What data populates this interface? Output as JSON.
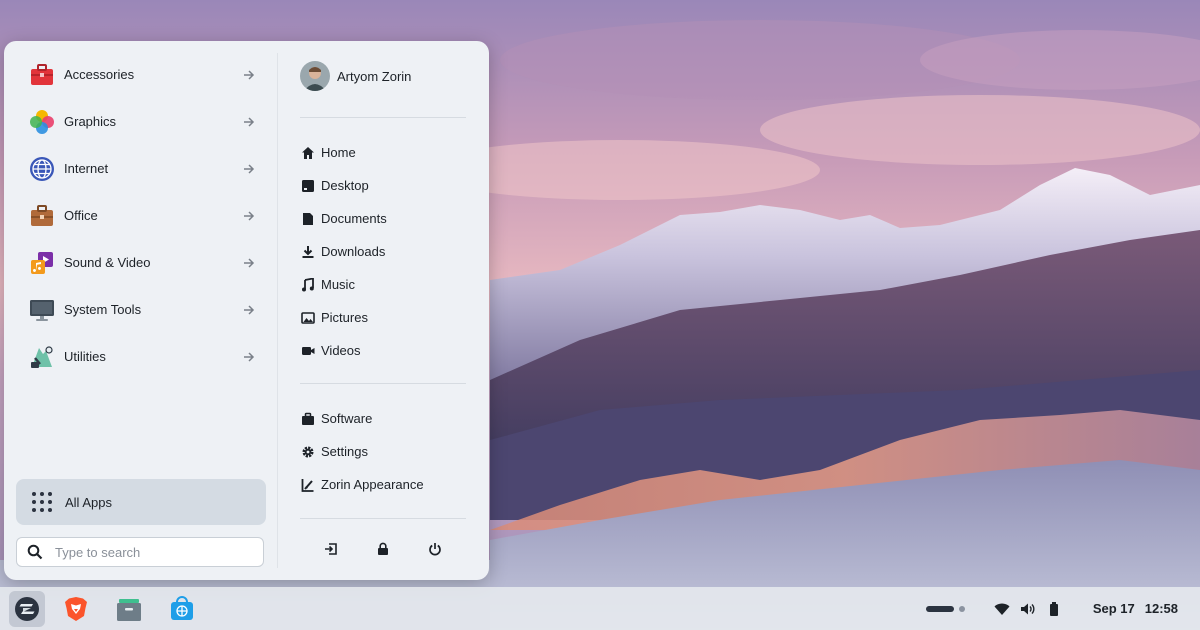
{
  "menu": {
    "categories": [
      {
        "label": "Accessories",
        "icon": "toolbox-icon"
      },
      {
        "label": "Graphics",
        "icon": "graphics-icon"
      },
      {
        "label": "Internet",
        "icon": "globe-icon"
      },
      {
        "label": "Office",
        "icon": "briefcase-icon"
      },
      {
        "label": "Sound & Video",
        "icon": "media-icon"
      },
      {
        "label": "System Tools",
        "icon": "monitor-icon"
      },
      {
        "label": "Utilities",
        "icon": "utilities-icon"
      }
    ],
    "all_apps_label": "All Apps",
    "search_placeholder": "Type to search",
    "user_name": "Artyom Zorin",
    "places": [
      {
        "label": "Home",
        "icon": "home-icon"
      },
      {
        "label": "Desktop",
        "icon": "desktop-icon"
      },
      {
        "label": "Documents",
        "icon": "document-icon"
      },
      {
        "label": "Downloads",
        "icon": "download-icon"
      },
      {
        "label": "Music",
        "icon": "music-icon"
      },
      {
        "label": "Pictures",
        "icon": "picture-icon"
      },
      {
        "label": "Videos",
        "icon": "video-icon"
      }
    ],
    "system": [
      {
        "label": "Software",
        "icon": "bag-icon"
      },
      {
        "label": "Settings",
        "icon": "gear-icon"
      },
      {
        "label": "Zorin Appearance",
        "icon": "appearance-icon"
      }
    ]
  },
  "taskbar": {
    "date": "Sep 17",
    "time": "12:58"
  },
  "colors": {
    "menu_bg": "#eef1f5",
    "selected_bg": "#d4dbe3",
    "text": "#1d2228"
  }
}
